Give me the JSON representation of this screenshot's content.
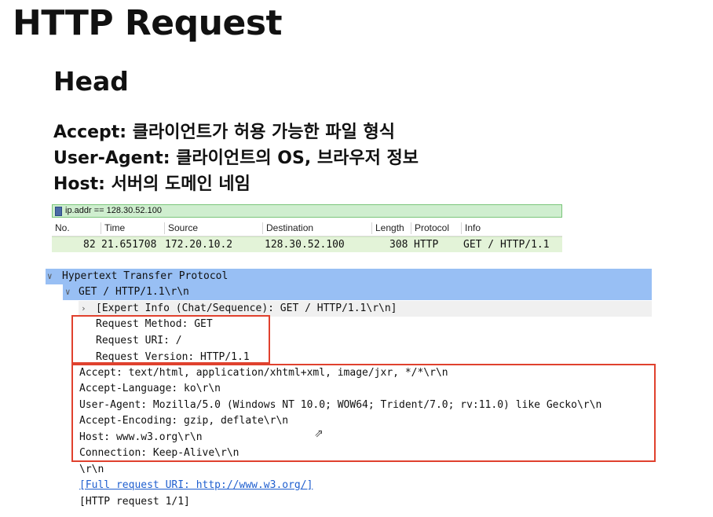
{
  "slide": {
    "title": "HTTP Request",
    "subtitle": "Head",
    "descriptions": [
      "Accept: 클라이언트가 허용 가능한 파일 형식",
      "User-Agent: 클라이언트의 OS, 브라우저 정보",
      "Host: 서버의 도메인 네임"
    ]
  },
  "wireshark": {
    "filter": "ip.addr == 128.30.52.100",
    "columns": [
      "No.",
      "Time",
      "Source",
      "Destination",
      "Length",
      "Protocol",
      "Info"
    ],
    "packet": {
      "no": "82",
      "time": "21.651708",
      "source": "172.20.10.2",
      "destination": "128.30.52.100",
      "length": "308",
      "protocol": "HTTP",
      "info": "GET / HTTP/1.1"
    },
    "tree": {
      "protocol": "Hypertext Transfer Protocol",
      "request_line": "GET / HTTP/1.1\\r\\n",
      "expert_info": "[Expert Info (Chat/Sequence): GET / HTTP/1.1\\r\\n]",
      "request_method": "Request Method: GET",
      "request_uri": "Request URI: /",
      "request_version": "Request Version: HTTP/1.1",
      "headers": [
        "Accept: text/html, application/xhtml+xml, image/jxr, */*\\r\\n",
        "Accept-Language: ko\\r\\n",
        "User-Agent: Mozilla/5.0 (Windows NT 10.0; WOW64; Trident/7.0; rv:11.0) like Gecko\\r\\n",
        "Accept-Encoding: gzip, deflate\\r\\n",
        "Host: www.w3.org\\r\\n",
        "Connection: Keep-Alive\\r\\n"
      ],
      "crlf": "\\r\\n",
      "full_uri": "[Full request URI: http://www.w3.org/]",
      "request_count": "[HTTP request 1/1]"
    }
  },
  "colors": {
    "highlight_blue": "#98bff4",
    "packet_row": "#e3f3d8",
    "filter_bg": "#cfeecf",
    "annotation_red": "#e0412e",
    "link": "#1f5fcf"
  }
}
